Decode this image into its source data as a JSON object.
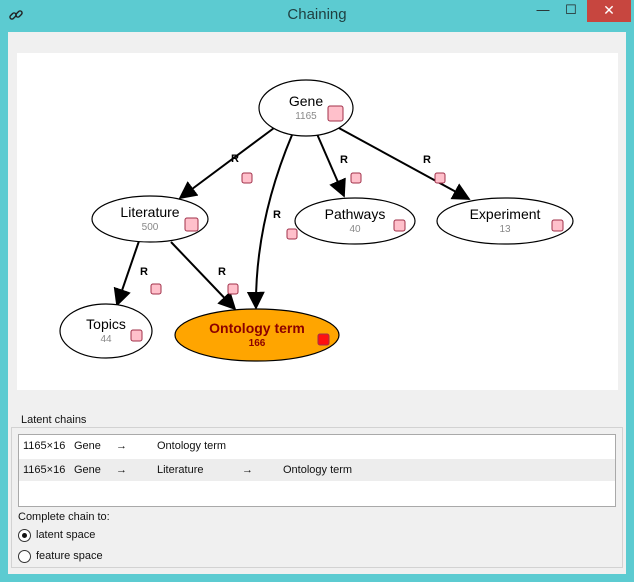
{
  "window": {
    "title": "Chaining",
    "app_icon": "link-icon",
    "controls": {
      "minimize": "—",
      "maximize": "☐",
      "close": "✕"
    }
  },
  "graph": {
    "relation_label": "R",
    "nodes": [
      {
        "id": "gene",
        "label": "Gene",
        "count": "1165",
        "highlighted": false
      },
      {
        "id": "literature",
        "label": "Literature",
        "count": "500",
        "highlighted": false
      },
      {
        "id": "pathways",
        "label": "Pathways",
        "count": "40",
        "highlighted": false
      },
      {
        "id": "experiment",
        "label": "Experiment",
        "count": "13",
        "highlighted": false
      },
      {
        "id": "topics",
        "label": "Topics",
        "count": "44",
        "highlighted": false
      },
      {
        "id": "ontology",
        "label": "Ontology term",
        "count": "166",
        "highlighted": true
      }
    ],
    "colors": {
      "node_fill": "#ffffff",
      "highlight_fill": "#ffa500",
      "highlight_text": "#8b0000",
      "box_fill": "#ffc0cb",
      "box_stroke": "#a0304a",
      "highlight_box_fill": "#ff1010",
      "count_text": "#888888"
    }
  },
  "latent_chains": {
    "title": "Latent chains",
    "rows": [
      {
        "shape": "1165×16",
        "cells": [
          "Gene",
          "→",
          "Ontology term"
        ]
      },
      {
        "shape": "1165×16",
        "cells": [
          "Gene",
          "→",
          "Literature",
          "→",
          "Ontology term"
        ]
      }
    ]
  },
  "complete": {
    "label": "Complete chain to:",
    "options": [
      {
        "label": "latent space",
        "checked": true
      },
      {
        "label": "feature space",
        "checked": false
      }
    ]
  }
}
